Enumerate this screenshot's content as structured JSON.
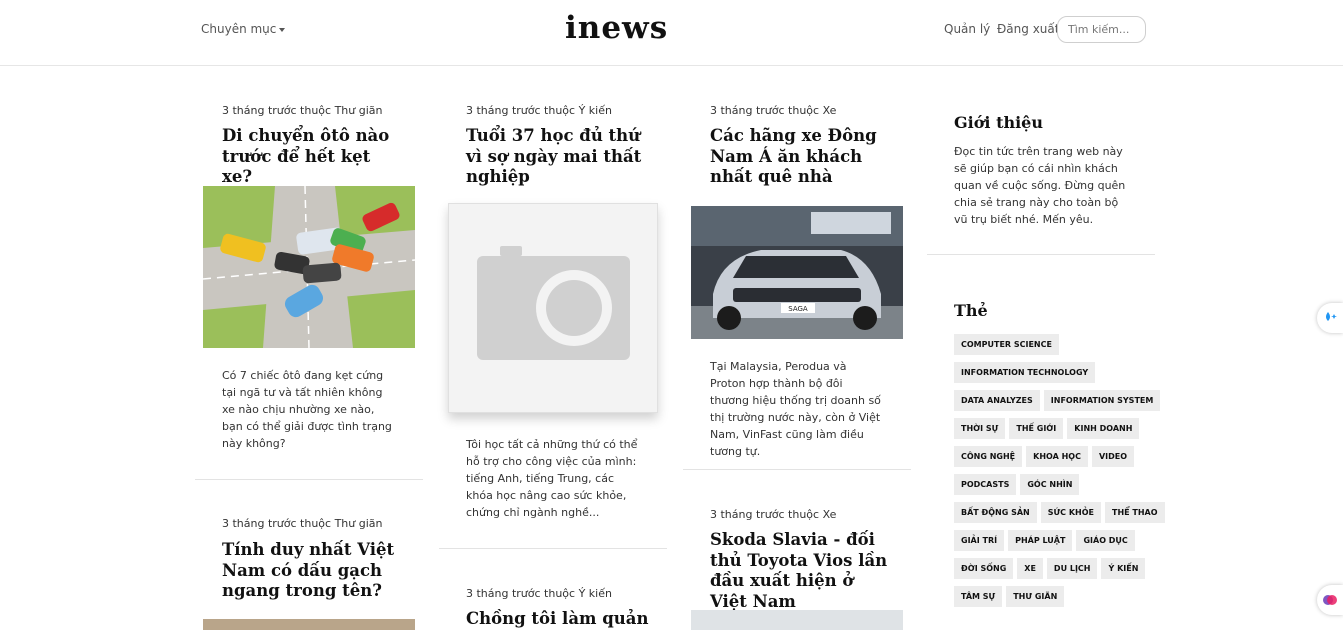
{
  "header": {
    "category_menu": "Chuyên mục",
    "logo": "inews",
    "manage": "Quản lý",
    "logout": "Đăng xuất",
    "search_placeholder": "Tìm kiếm..."
  },
  "articles": [
    {
      "meta": "3 tháng trước thuộc Thư giãn",
      "title": "Di chuyển ôtô nào trước để hết kẹt xe?",
      "excerpt": "Có 7 chiếc ôtô đang kẹt cứng tại ngã tư và tất nhiên không xe nào chịu nhường xe nào, bạn có thể giải được tình trạng này không?"
    },
    {
      "meta": "3 tháng trước thuộc Ý kiến",
      "title": "Tuổi 37 học đủ thứ vì sợ ngày mai thất nghiệp",
      "excerpt": "Tôi học tất cả những thứ có thể hỗ trợ cho công việc của mình: tiếng Anh, tiếng Trung, các khóa học nâng cao sức khỏe, chứng chỉ ngành nghề..."
    },
    {
      "meta": "3 tháng trước thuộc Xe",
      "title": "Các hãng xe Đông Nam Á ăn khách nhất quê nhà",
      "excerpt": "Tại Malaysia, Perodua và Proton hợp thành bộ đôi thương hiệu thống trị doanh số thị trường nước này, còn ở Việt Nam, VinFast cũng làm điều tương tự."
    },
    {
      "meta": "3 tháng trước thuộc Thư giãn",
      "title": "Tính duy nhất Việt Nam có dấu gạch ngang trong tên?"
    },
    {
      "meta": "3 tháng trước thuộc Ý kiến",
      "title": "Chồng tôi làm quản"
    },
    {
      "meta": "3 tháng trước thuộc Xe",
      "title": "Skoda Slavia - đối thủ Toyota Vios lần đầu xuất hiện ở Việt Nam"
    }
  ],
  "car_badge": "SAGA",
  "sidebar": {
    "intro_title": "Giới thiệu",
    "intro_text": "Đọc tin tức trên trang web này sẽ giúp bạn có cái nhìn khách quan về cuộc sống. Đừng quên chia sẻ trang này cho toàn bộ vũ trụ biết nhé. Mến yêu.",
    "tags_title": "Thẻ",
    "tags": [
      "Computer Science",
      "Information Technology",
      "Data Analyzes",
      "Information System",
      "Thời sự",
      "Thế giới",
      "Kinh doanh",
      "Công nghệ",
      "Khoa học",
      "Video",
      "Podcasts",
      "Góc nhìn",
      "Bất động sản",
      "Sức khỏe",
      "Thể thao",
      "Giải trí",
      "Pháp luật",
      "Giáo dục",
      "Đời sống",
      "Xe",
      "Du lịch",
      "Ý kiến",
      "Tâm sự",
      "Thư giãn"
    ]
  },
  "colors": {
    "tag_bg": "#ececec",
    "divider": "#e3e3e3",
    "text": "#111111"
  }
}
